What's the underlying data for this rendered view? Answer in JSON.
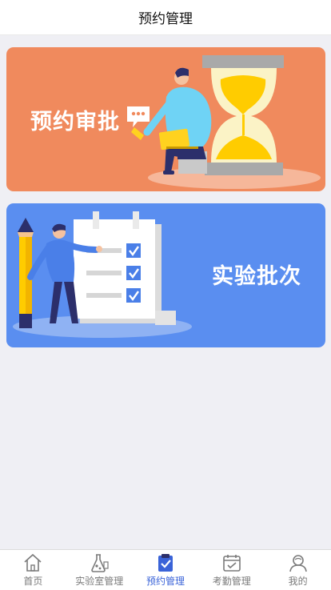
{
  "header": {
    "title": "预约管理"
  },
  "cards": [
    {
      "title": "预约审批"
    },
    {
      "title": "实验批次"
    }
  ],
  "tabbar": {
    "active_index": 2,
    "items": [
      {
        "label": "首页",
        "icon": "home-icon"
      },
      {
        "label": "实验室管理",
        "icon": "flask-icon"
      },
      {
        "label": "预约管理",
        "icon": "clipboard-check-icon"
      },
      {
        "label": "考勤管理",
        "icon": "calendar-check-icon"
      },
      {
        "label": "我的",
        "icon": "user-icon"
      }
    ]
  },
  "colors": {
    "approve_card": "#f08a5d",
    "batch_card": "#5a8ef0",
    "active_tab": "#3a63d8",
    "inactive_tab": "#7a7a7a"
  }
}
